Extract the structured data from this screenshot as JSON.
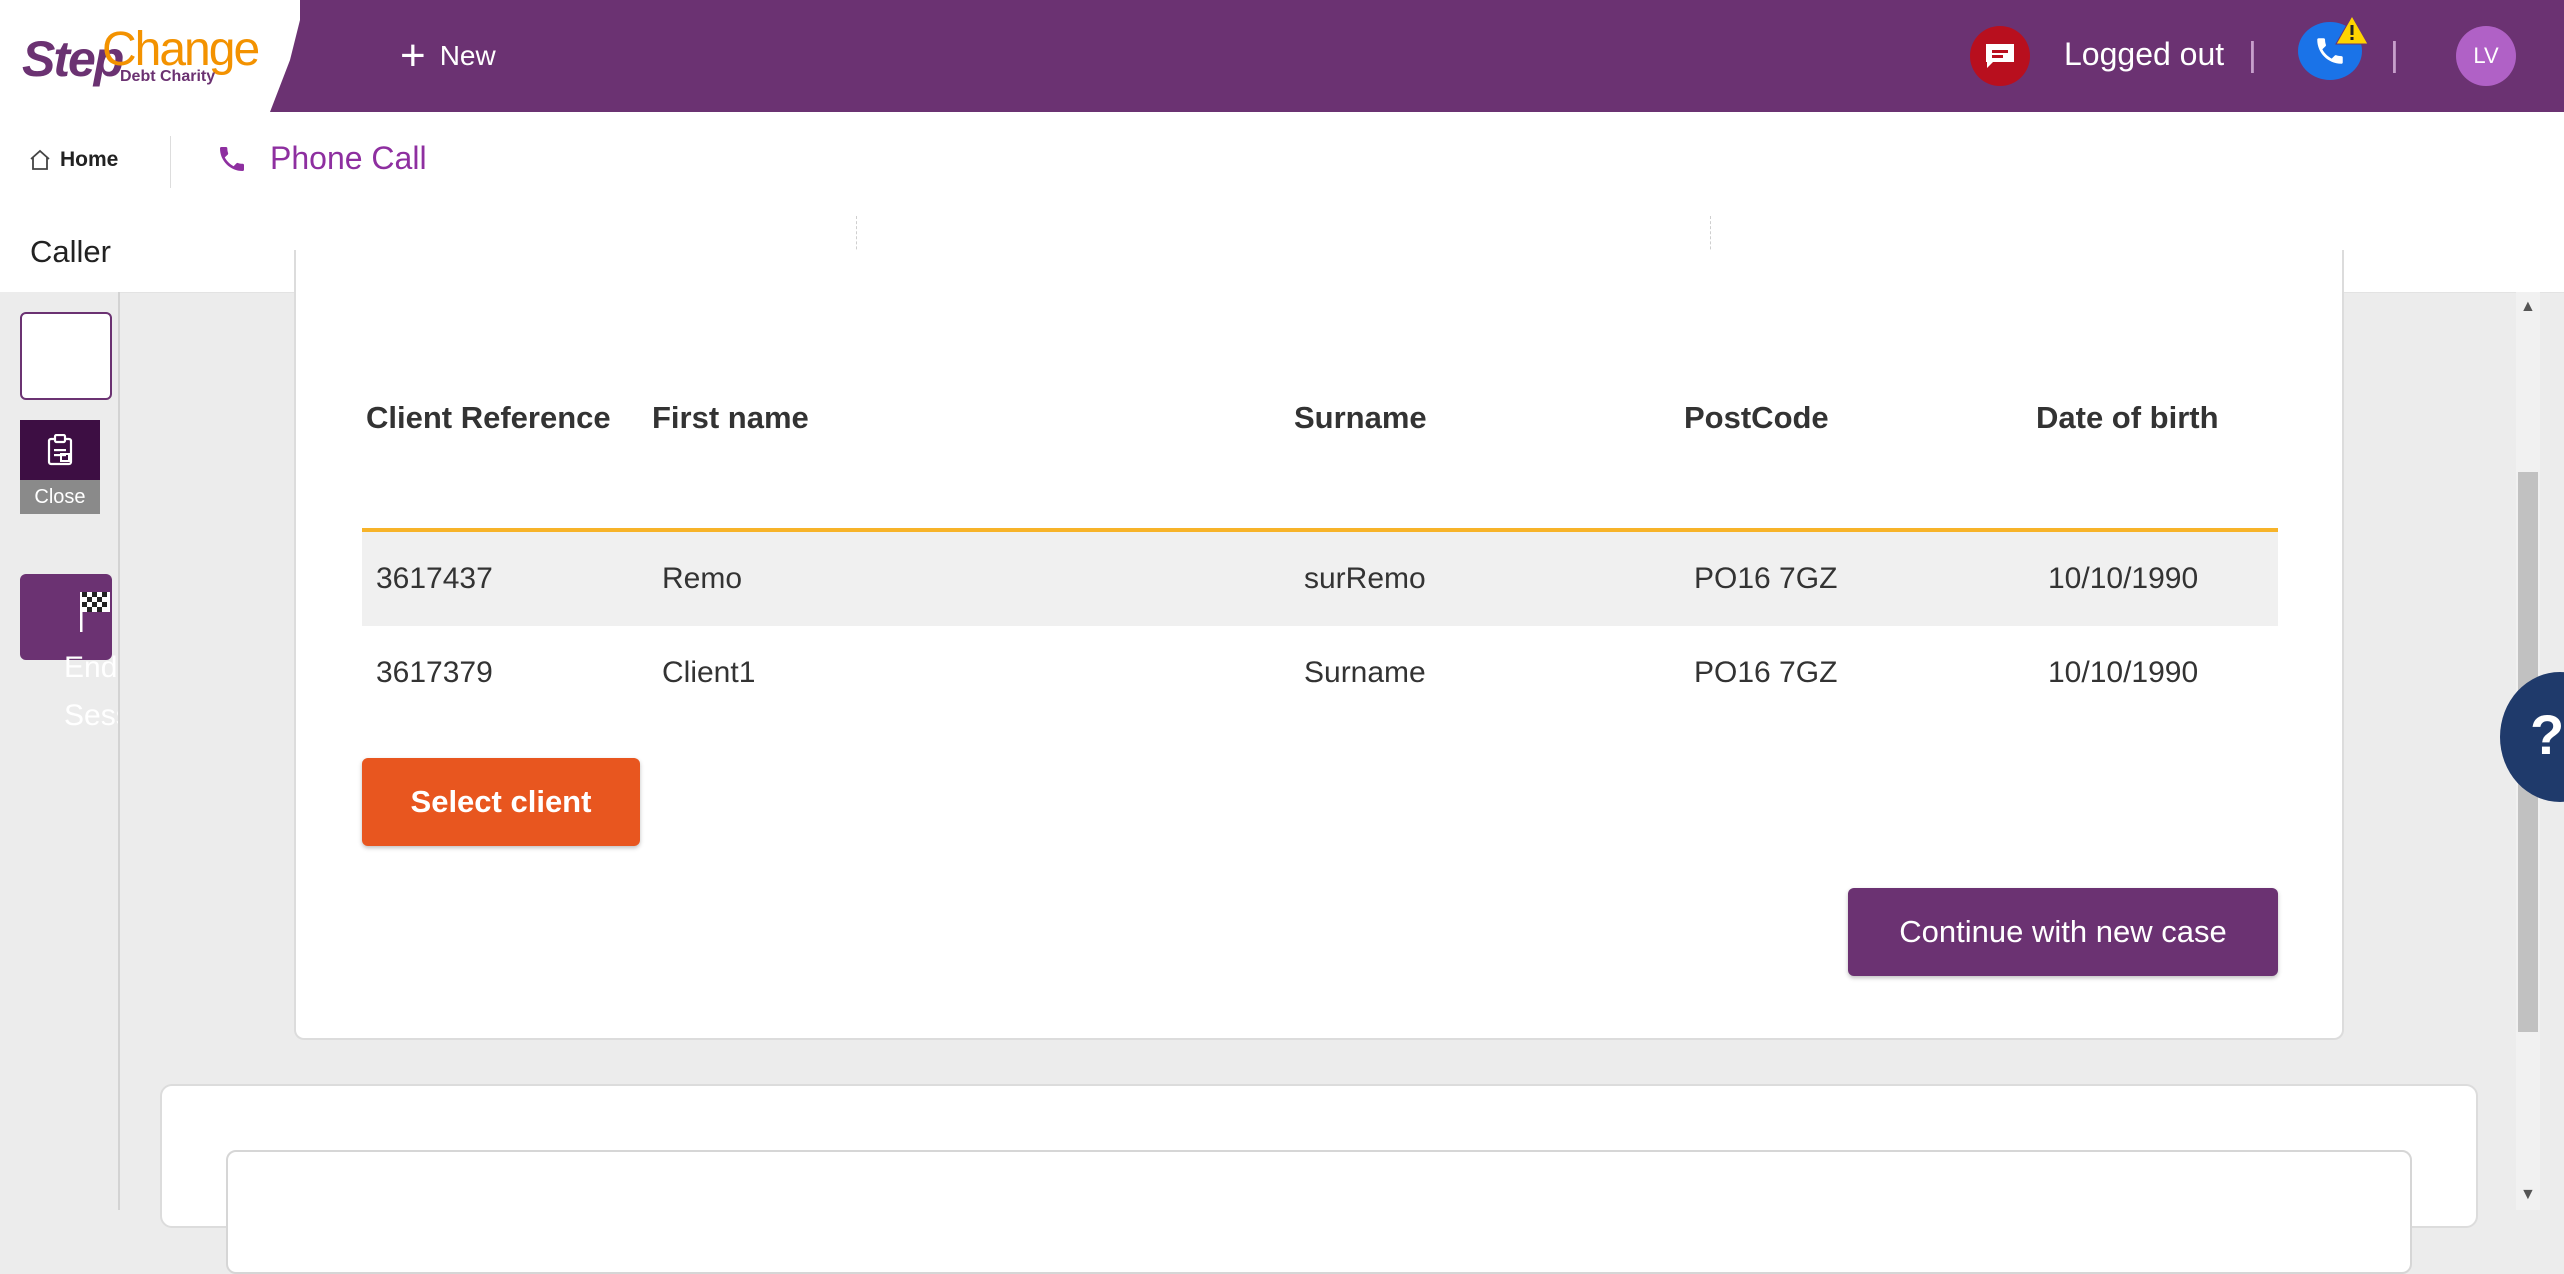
{
  "header": {
    "logo_step": "Step",
    "logo_change": "Change",
    "logo_tagline": "Debt Charity",
    "new_label": "New",
    "status_text": "Logged out",
    "separator": "|",
    "avatar_initials": "LV"
  },
  "nav": {
    "home_label": "Home",
    "tab_label": "Phone Call"
  },
  "caller": {
    "label": "Caller"
  },
  "leftrail": {
    "close_label": "Close",
    "end_session_label": "End Session"
  },
  "table": {
    "headers": [
      "Client Reference",
      "First name",
      "Surname",
      "PostCode",
      "Date of birth"
    ],
    "rows": [
      [
        "3617437",
        "Remo",
        "surRemo",
        "PO16 7GZ",
        "10/10/1990"
      ],
      [
        "3617379",
        "Client1",
        "Surname",
        "PO16 7GZ",
        "10/10/1990"
      ]
    ]
  },
  "actions": {
    "select_client": "Select client",
    "continue_new_case": "Continue with new case"
  },
  "help": {
    "glyph": "?"
  },
  "colors": {
    "brand_purple": "#6b3272",
    "brand_orange": "#f39200",
    "select_button": "#e8561f",
    "header_underline": "#f7b329",
    "chat_red": "#b80f1e",
    "phone_blue": "#1a73e8"
  }
}
